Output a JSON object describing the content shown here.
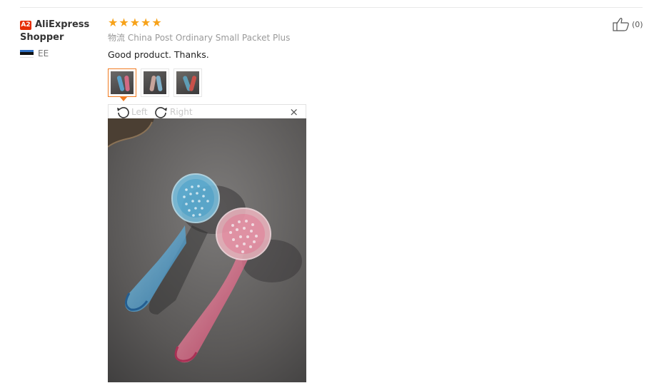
{
  "user": {
    "level_badge": "A2",
    "name": "AliExpress Shopper",
    "country": "EE"
  },
  "review": {
    "rating": 5,
    "logistics": "物流 China Post Ordinary Small Packet Plus",
    "text": "Good product. Thanks."
  },
  "viewer": {
    "rotate_left": "Left",
    "rotate_right": "Right",
    "close": "×"
  },
  "helpful": {
    "count": "(0)"
  },
  "colors": {
    "star": "#f7a219",
    "badge": "#e62e04",
    "active_thumb": "#f17b21"
  },
  "icons": [
    "star-icon",
    "rotate-left-icon",
    "rotate-right-icon",
    "close-icon",
    "thumbs-up-icon",
    "flag-icon"
  ]
}
